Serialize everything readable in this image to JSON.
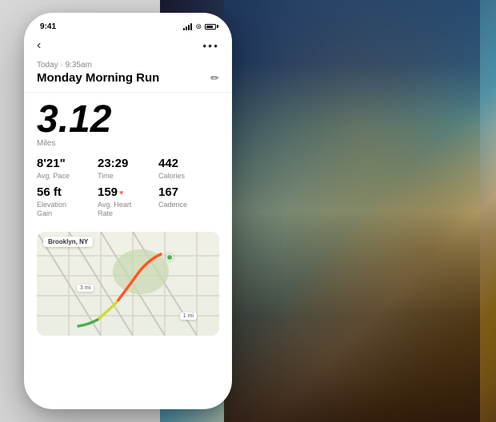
{
  "phone": {
    "status_bar": {
      "time": "9:41",
      "battery_label": "battery"
    },
    "nav": {
      "back_label": "‹",
      "more_label": "•••"
    },
    "header": {
      "date": "Today · 9:35am",
      "title": "Monday Morning Run",
      "edit_icon": "pencil"
    },
    "distance": {
      "value": "3.12",
      "unit": "Miles"
    },
    "stats_row1": [
      {
        "value": "8'21\"",
        "label": "Avg. Pace"
      },
      {
        "value": "23:29",
        "label": "Time"
      },
      {
        "value": "442",
        "label": "Calories"
      }
    ],
    "stats_row2": [
      {
        "value": "56 ft",
        "label_line1": "Elevation",
        "label_line2": "Gain"
      },
      {
        "value": "159",
        "label_line1": "Avg. Heart",
        "label_line2": "Rate",
        "has_heart": true
      },
      {
        "value": "167",
        "label_line1": "Cadence",
        "label_line2": ""
      }
    ],
    "map": {
      "location_label": "Brooklyn, NY",
      "mile_markers": [
        "3 mi",
        "1 mi"
      ]
    }
  }
}
